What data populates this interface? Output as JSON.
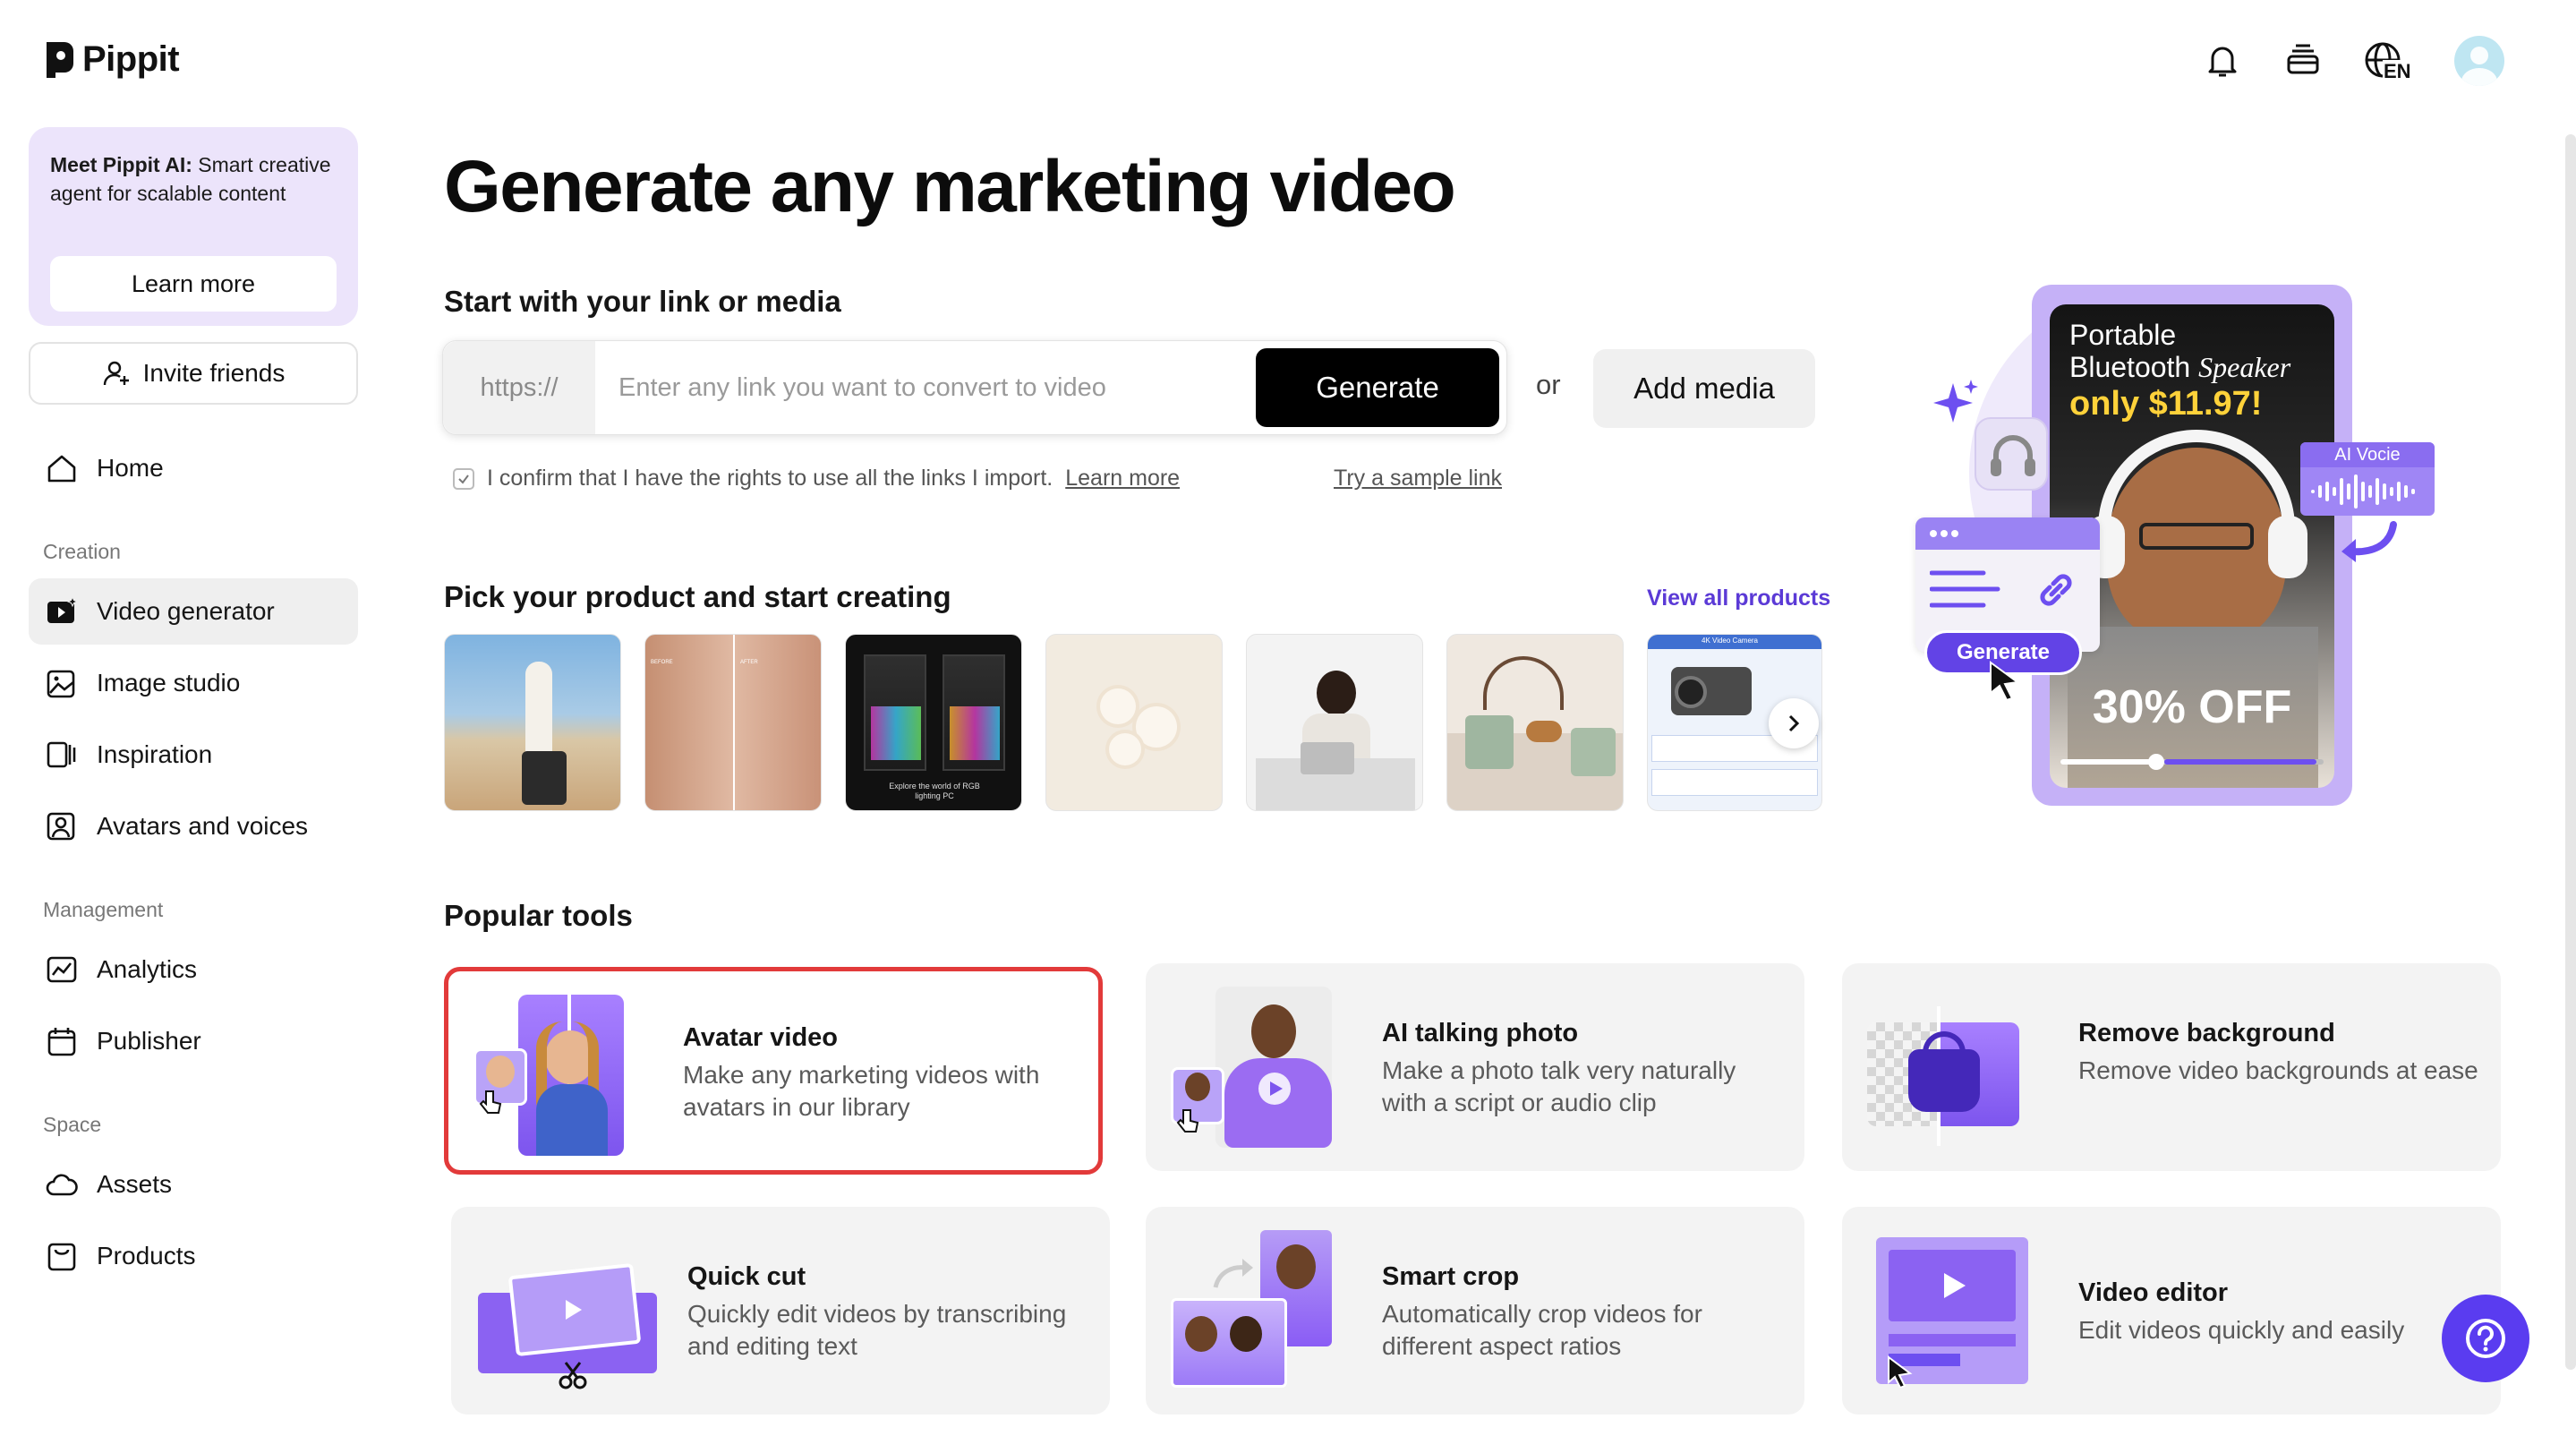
{
  "brand": {
    "name": "Pippit"
  },
  "promo": {
    "title_bold": "Meet Pippit AI:",
    "title_rest": " Smart creative agent for scalable content",
    "button": "Learn more"
  },
  "invite_label": "Invite friends",
  "nav": {
    "home": "Home",
    "section_creation": "Creation",
    "video_generator": "Video generator",
    "image_studio": "Image studio",
    "inspiration": "Inspiration",
    "avatars_voices": "Avatars and voices",
    "section_management": "Management",
    "analytics": "Analytics",
    "publisher": "Publisher",
    "section_space": "Space",
    "assets": "Assets",
    "products": "Products"
  },
  "topbar": {
    "language": "EN"
  },
  "main": {
    "title": "Generate any marketing video",
    "link_section": "Start with your link or media",
    "prefix": "https://",
    "placeholder": "Enter any link you want to convert to video",
    "generate": "Generate",
    "or": "or",
    "add_media": "Add media",
    "confirm_text": "I confirm that I have the rights to use all the links I import.",
    "confirm_link": "Learn more",
    "sample_link": "Try a sample link",
    "products_heading": "Pick your product and start creating",
    "view_all": "View all products",
    "product_thumb_texts": [
      "BEFORE",
      "AFTER",
      "Explore the world of RGB lighting PC",
      "4K Video Camera"
    ],
    "popular_heading": "Popular tools"
  },
  "hero": {
    "headline1": "Portable",
    "headline2": "Bluetooth ",
    "headline2_italic": "Speaker",
    "price": "only $11.97!",
    "discount": "30% OFF",
    "voice_badge": "AI Vocie",
    "generate_chip": "Generate"
  },
  "tools": [
    {
      "title": "Avatar video",
      "desc": "Make any marketing videos with avatars in our library"
    },
    {
      "title": "AI talking photo",
      "desc": "Make a photo talk very naturally with a script or audio clip"
    },
    {
      "title": "Remove background",
      "desc": "Remove video backgrounds at ease"
    },
    {
      "title": "Quick cut",
      "desc": "Quickly edit videos by transcribing and editing text"
    },
    {
      "title": "Smart crop",
      "desc": "Automatically crop videos for different aspect ratios"
    },
    {
      "title": "Video editor",
      "desc": "Edit videos quickly and easily"
    }
  ],
  "colors": {
    "accent": "#5b3ad6",
    "selected_border": "#e23a3a",
    "purple": "#8a5cf5"
  }
}
